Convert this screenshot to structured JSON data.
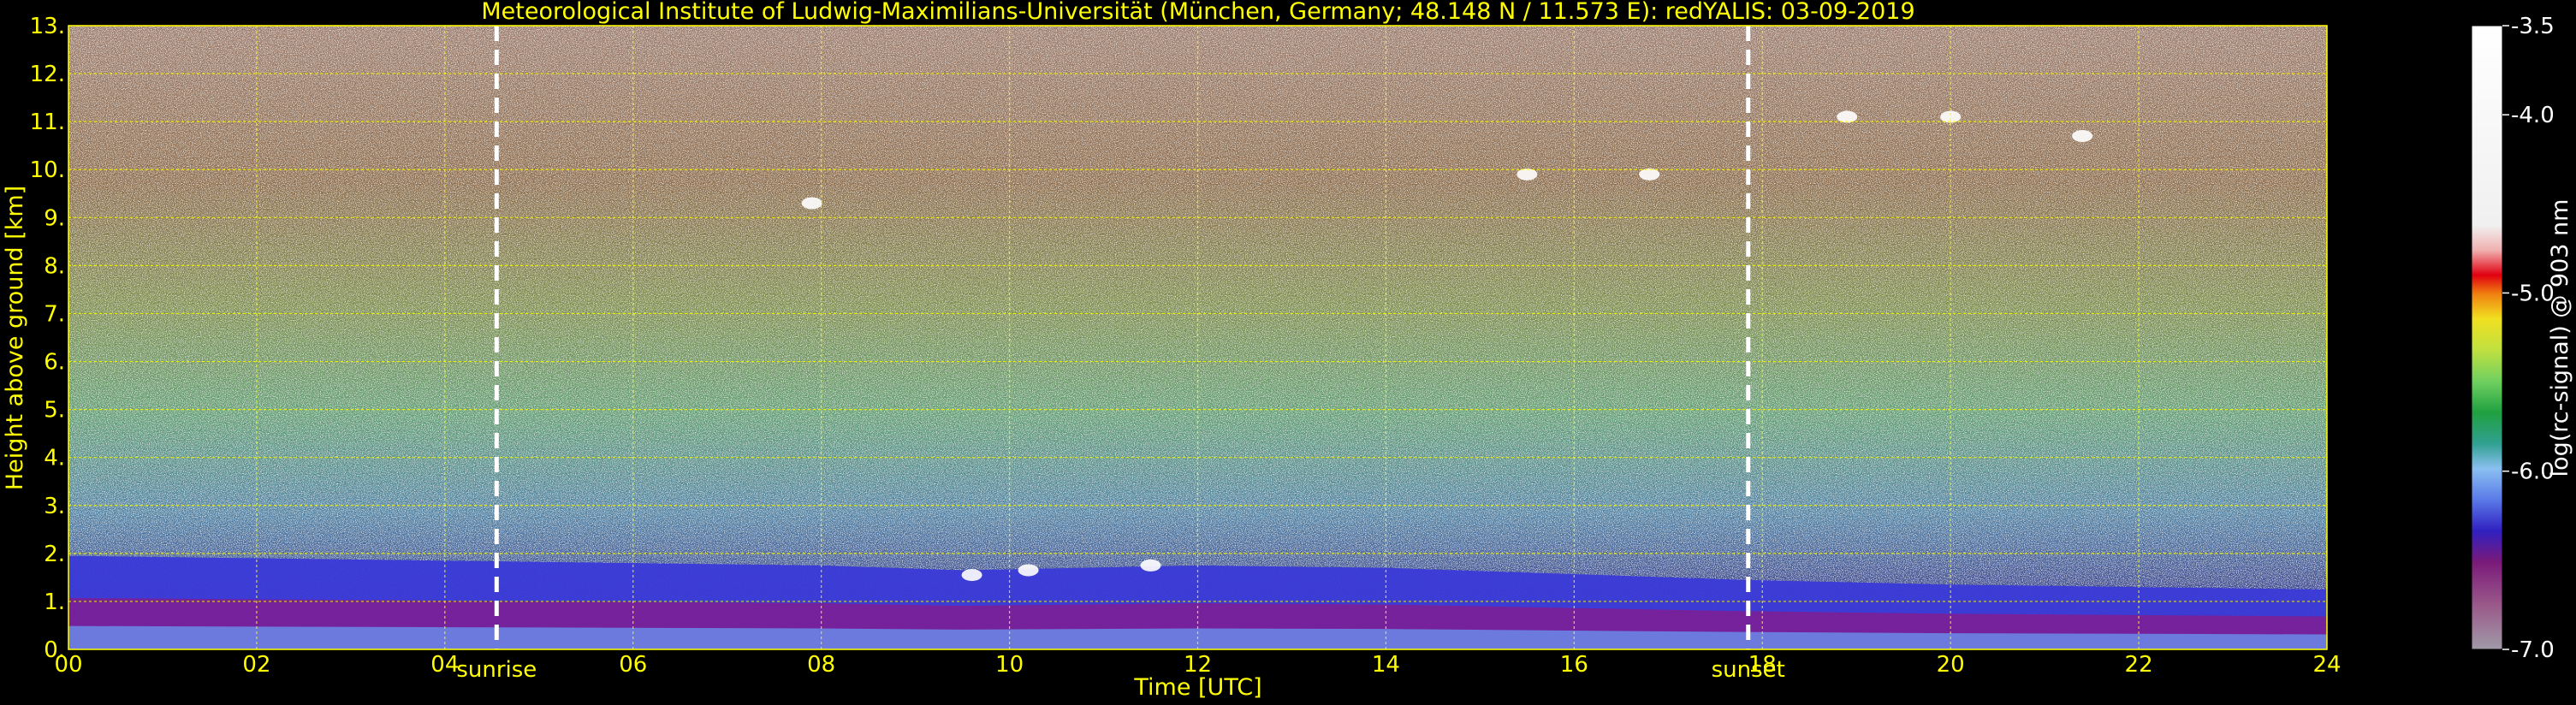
{
  "chart_data": {
    "type": "heatmap",
    "title": "Meteorological Institute of Ludwig-Maximilians-Universität (München, Germany; 48.148 N / 11.573 E):    redYALIS: 03-09-2019",
    "xlabel": "Time [UTC]",
    "ylabel": "Height above ground [km]",
    "colorbar_label": "log(rc-signal) @ 903 nm",
    "xlim": [
      0,
      24
    ],
    "ylim": [
      0,
      13
    ],
    "clim": [
      -7.0,
      -3.5
    ],
    "x_ticks": [
      0,
      2,
      4,
      6,
      8,
      10,
      12,
      14,
      16,
      18,
      20,
      22,
      24
    ],
    "x_tick_labels": [
      "00",
      "02",
      "04",
      "06",
      "08",
      "10",
      "12",
      "14",
      "16",
      "18",
      "20",
      "22",
      "24"
    ],
    "y_ticks": [
      0,
      1,
      2,
      3,
      4,
      5,
      6,
      7,
      8,
      9,
      10,
      11,
      12,
      13
    ],
    "y_tick_labels": [
      "0.",
      "1.",
      "2.",
      "3.",
      "4.",
      "5.",
      "6.",
      "7.",
      "8.",
      "9.",
      "10.",
      "11.",
      "12.",
      "13."
    ],
    "colorbar_ticks": [
      -7.0,
      -6.0,
      -5.0,
      -4.0,
      -3.5
    ],
    "colorbar_tick_labels": [
      "-7.0",
      "-6.0",
      "-5.0",
      "-4.0",
      "-3.5"
    ],
    "grid": true,
    "annotations": [
      {
        "text": "sunrise",
        "x": 4.55
      },
      {
        "text": "sunset",
        "x": 17.85
      }
    ],
    "boundary_layer_top_km": [
      {
        "x": 0,
        "y": 1.95
      },
      {
        "x": 4,
        "y": 1.85
      },
      {
        "x": 8,
        "y": 1.75
      },
      {
        "x": 9.5,
        "y": 1.65
      },
      {
        "x": 12,
        "y": 1.75
      },
      {
        "x": 14,
        "y": 1.7
      },
      {
        "x": 17.8,
        "y": 1.45
      },
      {
        "x": 20,
        "y": 1.35
      },
      {
        "x": 24,
        "y": 1.25
      }
    ],
    "clouds": [
      {
        "x": 7.9,
        "y": 9.3
      },
      {
        "x": 9.6,
        "y": 1.55
      },
      {
        "x": 10.2,
        "y": 1.65
      },
      {
        "x": 11.5,
        "y": 1.75
      },
      {
        "x": 15.5,
        "y": 9.9
      },
      {
        "x": 16.8,
        "y": 9.9
      },
      {
        "x": 18.9,
        "y": 11.1
      },
      {
        "x": 20.0,
        "y": 11.1
      },
      {
        "x": 21.4,
        "y": 10.7
      }
    ],
    "colors": {
      "text": "#ffff00",
      "grid": "#ffff00",
      "colorbar_label": "#ffffff",
      "markers": "#ffffff"
    }
  }
}
